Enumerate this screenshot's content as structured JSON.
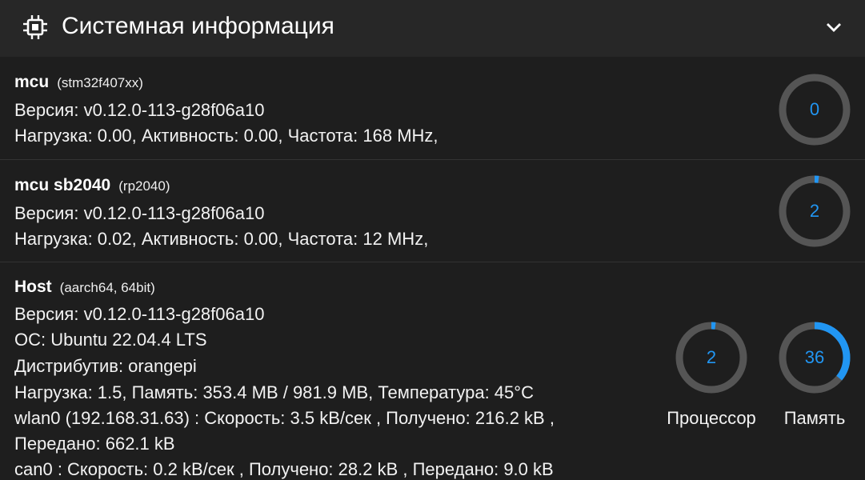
{
  "header": {
    "title": "Системная информация",
    "icon": "cpu-chip-icon",
    "collapse_icon": "chevron-down-icon"
  },
  "colors": {
    "background": "#1e1e1e",
    "header_background": "#272727",
    "gauge_track": "#555555",
    "gauge_fill": "#2196f3"
  },
  "mcus": [
    {
      "name": "mcu",
      "chip": "(stm32f407xx)",
      "version": "Версия: v0.12.0-113-g28f06a10",
      "stats": "Нагрузка: 0.00, Активность: 0.00, Частота: 168 MHz,",
      "gauge_value": "0",
      "gauge_percent": 0
    },
    {
      "name": "mcu sb2040",
      "chip": "(rp2040)",
      "version": "Версия: v0.12.0-113-g28f06a10",
      "stats": "Нагрузка: 0.02, Активность: 0.00, Частота: 12 MHz,",
      "gauge_value": "2",
      "gauge_percent": 2
    }
  ],
  "host": {
    "name": "Host",
    "arch": "(aarch64, 64bit)",
    "version": "Версия: v0.12.0-113-g28f06a10",
    "os": "ОС: Ubuntu 22.04.4 LTS",
    "distro": "Дистрибутив: orangepi",
    "load": "Нагрузка: 1.5, Память: 353.4 MB / 981.9 MB, Температура: 45°C",
    "wlan_line1": "wlan0 (192.168.31.63) : Скорость: 3.5 kB/сек , Получено: 216.2 kB ,",
    "wlan_line2": "Передано: 662.1 kB",
    "can0": "can0 : Скорость: 0.2 kB/сек , Получено: 28.2 kB , Передано: 9.0 kB",
    "cpu_gauge": {
      "value": "2",
      "percent": 2,
      "label": "Процессор"
    },
    "mem_gauge": {
      "value": "36",
      "percent": 36,
      "label": "Память"
    }
  }
}
